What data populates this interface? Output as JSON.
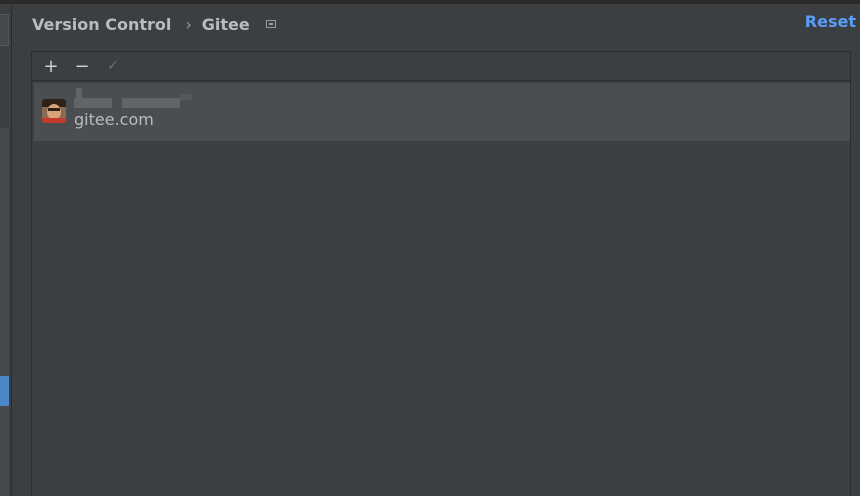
{
  "header": {
    "breadcrumb_parent": "Version Control",
    "breadcrumb_separator": "›",
    "breadcrumb_current": "Gitee",
    "reset_label": "Reset"
  },
  "toolbar": {
    "add_label": "+",
    "remove_label": "−",
    "default_label": "✓"
  },
  "accounts": [
    {
      "name": "",
      "host": "gitee.com"
    }
  ],
  "colors": {
    "accent": "#589df6",
    "background": "#3c3f41",
    "selection": "#4b4e50",
    "scroll_thumb": "#4a88c7"
  },
  "icons": {
    "breadcrumb_icon": "project-scope-icon",
    "avatar": "user-avatar"
  }
}
